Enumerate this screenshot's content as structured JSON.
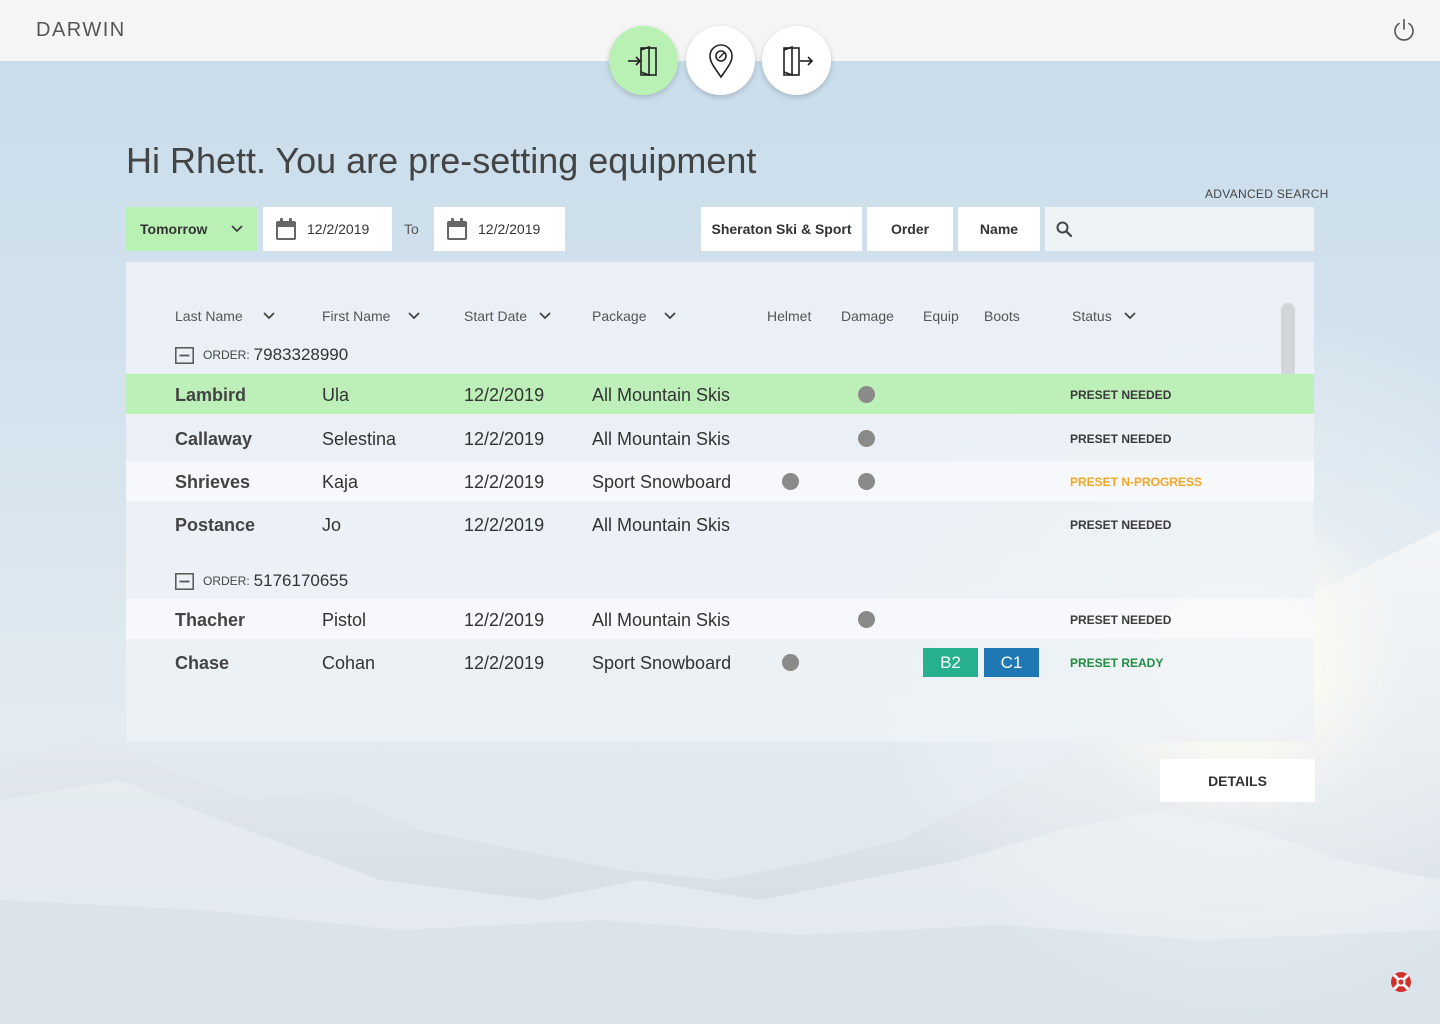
{
  "app": {
    "brand": "DARWIN"
  },
  "greeting": "Hi Rhett. You are pre-setting equipment",
  "advanced_search": "ADVANCED SEARCH",
  "filters": {
    "range": "Tomorrow",
    "from_date": "12/2/2019",
    "to_label": "To",
    "to_date": "12/2/2019",
    "location": "Sheraton Ski & Sport",
    "order_chip": "Order",
    "name_chip": "Name",
    "search_value": ""
  },
  "columns": {
    "last_name": "Last Name",
    "first_name": "First Name",
    "start_date": "Start Date",
    "package": "Package",
    "helmet": "Helmet",
    "damage": "Damage",
    "equip": "Equip",
    "boots": "Boots",
    "status": "Status"
  },
  "orders": [
    {
      "label": "ORDER:",
      "number": "7983328990",
      "rows": [
        {
          "last": "Lambird",
          "first": "Ula",
          "start": "12/2/2019",
          "package": "All Mountain Skis",
          "helmet": false,
          "damage": true,
          "status": "PRESET NEEDED"
        },
        {
          "last": "Callaway",
          "first": "Selestina",
          "start": "12/2/2019",
          "package": "All Mountain Skis",
          "helmet": false,
          "damage": true,
          "status": "PRESET NEEDED"
        },
        {
          "last": "Shrieves",
          "first": "Kaja",
          "start": "12/2/2019",
          "package": "Sport Snowboard",
          "helmet": true,
          "damage": true,
          "status": "PRESET N-PROGRESS"
        },
        {
          "last": "Postance",
          "first": "Jo",
          "start": "12/2/2019",
          "package": "All Mountain Skis",
          "helmet": false,
          "damage": false,
          "status": "PRESET NEEDED"
        }
      ]
    },
    {
      "label": "ORDER:",
      "number": "5176170655",
      "rows": [
        {
          "last": "Thacher",
          "first": "Pistol",
          "start": "12/2/2019",
          "package": "All Mountain Skis",
          "helmet": false,
          "damage": true,
          "status": "PRESET NEEDED"
        },
        {
          "last": "Chase",
          "first": "Cohan",
          "start": "12/2/2019",
          "package": "Sport Snowboard",
          "helmet": true,
          "damage": false,
          "equip": "B2",
          "boots": "C1",
          "status": "PRESET READY"
        }
      ]
    }
  ],
  "details_button": "DETAILS",
  "colors": {
    "accent_green": "#b9f0b4",
    "selected_row": "#bdf0b8",
    "status_progress": "#f5a623",
    "status_ready": "#1e8e3e",
    "equip_tag": "#26b08e",
    "boots_tag": "#1f78b4",
    "help_icon": "#d0312d"
  },
  "icons": {
    "check_in": "door-enter-icon",
    "location": "location-pin-icon",
    "check_out": "door-exit-icon",
    "power": "power-icon",
    "calendar": "calendar-icon",
    "search": "search-icon",
    "help": "lifebuoy-icon"
  }
}
